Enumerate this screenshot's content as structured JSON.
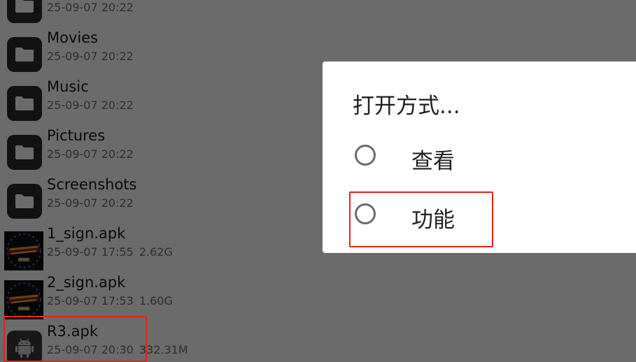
{
  "file_list": {
    "items": [
      {
        "name": "",
        "date": "25-09-07 20:22",
        "size": "",
        "icon": "folder-icon"
      },
      {
        "name": "Movies",
        "date": "25-09-07 20:22",
        "size": "",
        "icon": "folder-icon"
      },
      {
        "name": "Music",
        "date": "25-09-07 20:22",
        "size": "",
        "icon": "folder-icon"
      },
      {
        "name": "Pictures",
        "date": "25-09-07 20:22",
        "size": "",
        "icon": "folder-icon"
      },
      {
        "name": "Screenshots",
        "date": "25-09-07 20:22",
        "size": "",
        "icon": "folder-icon"
      },
      {
        "name": "1_sign.apk",
        "date": "25-09-07 17:55",
        "size": "2.62G",
        "icon": "apk-game-thumbnail"
      },
      {
        "name": "2_sign.apk",
        "date": "25-09-07 17:53",
        "size": "1.60G",
        "icon": "apk-game-thumbnail"
      },
      {
        "name": "R3.apk",
        "date": "25-09-07 20:30",
        "size": "332.31M",
        "icon": "android-icon"
      }
    ]
  },
  "dialog": {
    "title": "打开方式...",
    "options": [
      {
        "label": "查看",
        "selected": false
      },
      {
        "label": "功能",
        "selected": false
      }
    ]
  },
  "colors": {
    "highlight": "#e0251c",
    "scrim": "rgba(0,0,0,0.58)"
  }
}
